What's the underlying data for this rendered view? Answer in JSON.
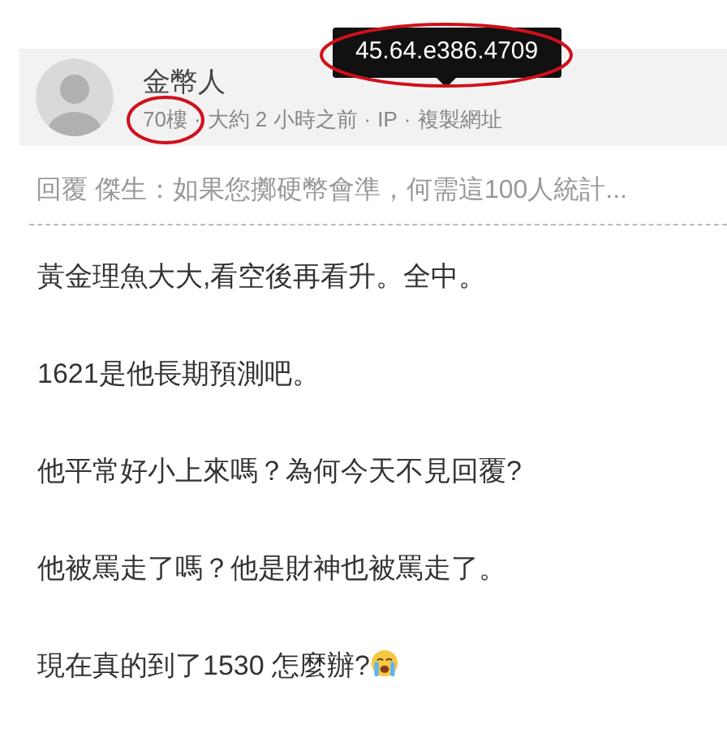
{
  "post": {
    "author": "金幣人",
    "floor": "70樓",
    "time": "大約 2 小時之前",
    "ip_link": "IP",
    "copy_link": "複製網址",
    "separator": "·"
  },
  "tooltip": {
    "text": "45.64.e386.4709"
  },
  "reply_quote": "回覆 傑生：如果您擲硬幣會準，何需這100人統計...",
  "paragraphs": [
    {
      "text": "黃金理魚大大,看空後再看升。全中。"
    },
    {
      "text": "1621是他長期預測吧。"
    },
    {
      "text": "他平常好小上來嗎？為何今天不見回覆?"
    },
    {
      "text": "他被罵走了嗎？他是財神也被罵走了。"
    },
    {
      "text": "現在真的到了1530 怎麼辦?",
      "has_emoji": true
    }
  ]
}
